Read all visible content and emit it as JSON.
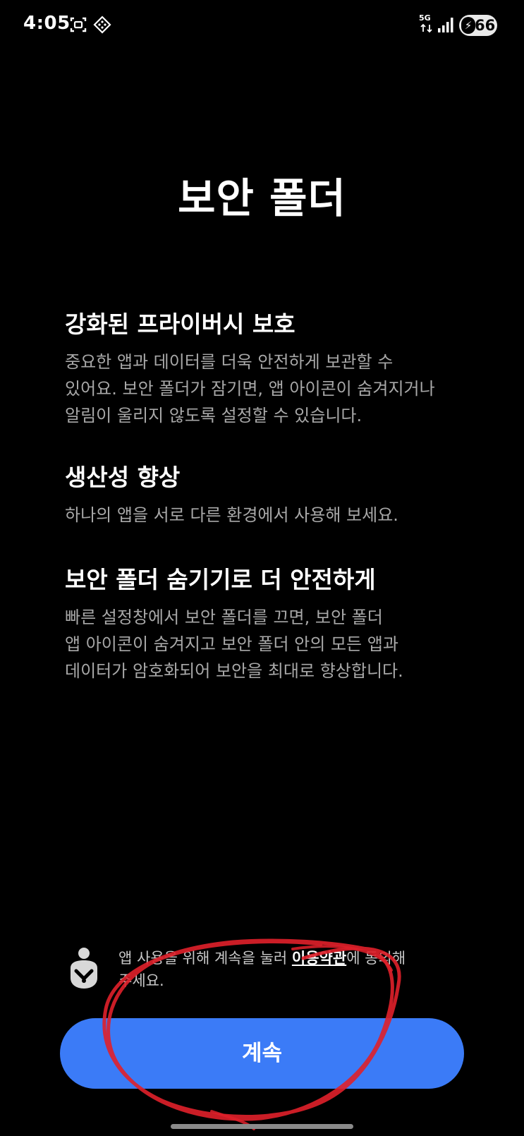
{
  "status_bar": {
    "time": "4:05",
    "network": "5G",
    "battery_level": "66",
    "icons": [
      "screenshot-icon",
      "diamond-grid-icon",
      "5g-icon",
      "signal-icon",
      "battery-charging-icon"
    ]
  },
  "page": {
    "title": "보안 폴더"
  },
  "sections": [
    {
      "heading": "강화된 프라이버시 보호",
      "lines": [
        "중요한 앱과 데이터를 더욱 안전하게 보관할 수",
        "있어요. 보안 폴더가 잠기면, 앱 아이콘이 숨겨지거나",
        "알림이 울리지 않도록 설정할 수 있습니다."
      ]
    },
    {
      "heading": "생산성 향상",
      "lines": [
        "하나의 앱을 서로 다른 환경에서 사용해 보세요."
      ]
    },
    {
      "heading": "보안 폴더 숨기기로 더 안전하게",
      "lines": [
        "빠른 설정창에서 보안 폴더를 끄면, 보안 폴더",
        "앱 아이콘이 숨겨지고 보안 폴더 안의 모든 앱과",
        "데이터가 암호화되어 보안을 최대로 향상합니다."
      ]
    }
  ],
  "terms": {
    "prefix": "앱 사용을 위해 계속을 눌러 ",
    "link": "이용약관",
    "suffix_line1": "에 동의해",
    "line2": "주세요."
  },
  "button": {
    "label": "계속",
    "color": "#3b7bf7"
  },
  "annotation_color": "#e0202a"
}
